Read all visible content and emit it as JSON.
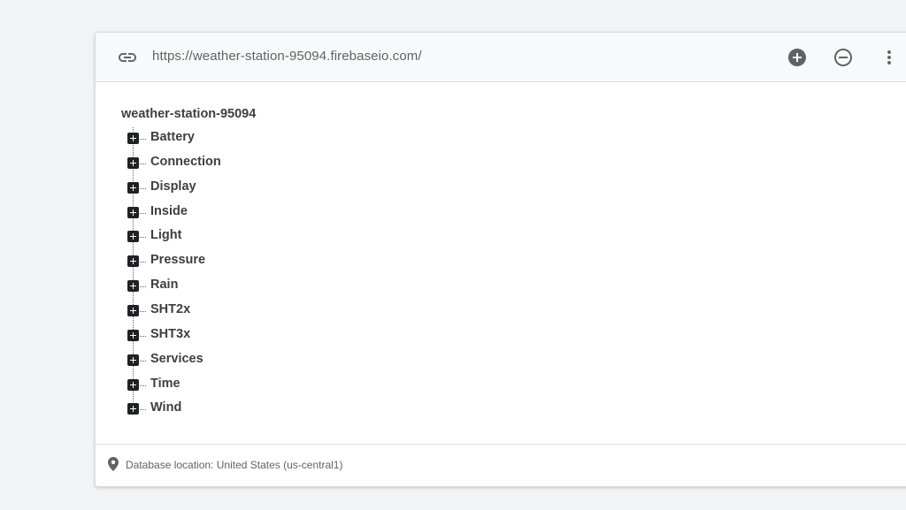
{
  "toolbar": {
    "url": "https://weather-station-95094.firebaseio.com/",
    "link_icon": "link-icon",
    "add_icon": "add-circle-icon",
    "remove_icon": "remove-circle-icon",
    "more_icon": "more-vert-icon"
  },
  "tree": {
    "root": "weather-station-95094",
    "children": [
      {
        "label": "Battery"
      },
      {
        "label": "Connection"
      },
      {
        "label": "Display"
      },
      {
        "label": "Inside"
      },
      {
        "label": "Light"
      },
      {
        "label": "Pressure"
      },
      {
        "label": "Rain"
      },
      {
        "label": "SHT2x"
      },
      {
        "label": "SHT3x"
      },
      {
        "label": "Services"
      },
      {
        "label": "Time"
      },
      {
        "label": "Wind"
      }
    ]
  },
  "footer": {
    "icon": "location-pin-icon",
    "text": "Database location: United States (us-central1)"
  },
  "colors": {
    "background": "#f1f3f4",
    "text": "#3c4043",
    "muted": "#5f6368"
  }
}
